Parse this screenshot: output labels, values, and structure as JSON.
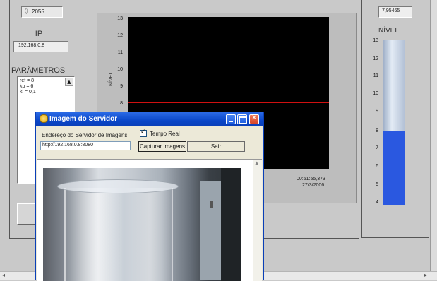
{
  "left_panel": {
    "port_value": "2055",
    "ip_label": "IP",
    "ip_value": "192.168.0.8",
    "params_label": "PARÂMETROS",
    "params_lines": [
      "ref = 8",
      "kp = 6",
      "ki = 0,1"
    ]
  },
  "chart": {
    "y_axis_label": "NÍVEL",
    "y_ticks": [
      "13",
      "12",
      "11",
      "10",
      "9",
      "8"
    ],
    "timestamp_time": "00:51:55,373",
    "timestamp_date": "27/3/2006",
    "line_color": "#d01010"
  },
  "level_meter": {
    "value": "7,95465",
    "label": "NÍVEL",
    "ticks": [
      "13",
      "12",
      "11",
      "10",
      "9",
      "8",
      "7",
      "6",
      "5",
      "4"
    ],
    "fill_level": 7.95465,
    "fill_color": "#2a58e0"
  },
  "dialog": {
    "title": "Imagem do Servidor",
    "server_address_label": "Endereço do Servidor de Imagens",
    "server_address_value": "http://192.168.0.8:8080",
    "realtime_label": "Tempo Real",
    "capture_button": "Capturar Imagens",
    "exit_button": "Sair"
  }
}
